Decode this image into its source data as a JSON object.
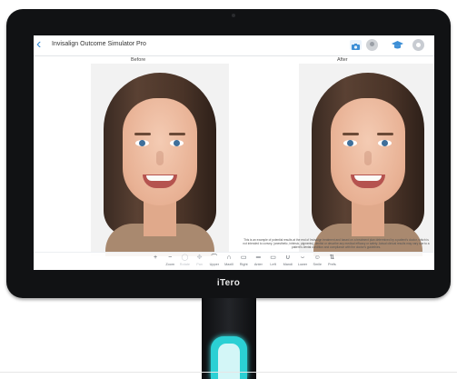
{
  "app": {
    "title": "Invisalign Outcome Simulator Pro",
    "brand": "iTero"
  },
  "header": {
    "back_icon": "chevron-left-icon",
    "camera_icon": "camera-icon",
    "avatar_icon": "user-avatar-icon",
    "graduation_icon": "graduation-cap-icon",
    "settings_icon": "gear-icon",
    "accent_color": "#3d8fd6"
  },
  "panels": {
    "before_label": "Before",
    "after_label": "After"
  },
  "disclaimer": "This is an example of potential results at the end of Invisalign treatment and based on a treatment plan determined by a patient's doctor, which is not intended to convey, (anesthetic, intrinsic, pigments), dentist or describe any medical efficacy or safety. Actual clinical results may vary due to a patient's dental condition and compliance with the doctor's guidelines.",
  "toolbar": {
    "tools": [
      {
        "icon": "+",
        "label": "",
        "name": "zoom-in-icon",
        "enabled": true
      },
      {
        "icon": "−",
        "label": "Zoom",
        "name": "zoom-out-icon",
        "enabled": true
      },
      {
        "icon": "◯",
        "label": "Rotate",
        "name": "rotate-icon",
        "enabled": false
      },
      {
        "icon": "✥",
        "label": "Pan",
        "name": "pan-icon",
        "enabled": false
      },
      {
        "icon": "⌒",
        "label": "Upper",
        "name": "upper-jaw-icon",
        "enabled": true
      },
      {
        "icon": "∩",
        "label": "Maxill",
        "name": "maxill-icon",
        "enabled": true
      },
      {
        "icon": "▭",
        "label": "Right",
        "name": "right-view-icon",
        "enabled": true
      },
      {
        "icon": "═",
        "label": "Anter",
        "name": "anterior-view-icon",
        "enabled": true
      },
      {
        "icon": "▭",
        "label": "Left",
        "name": "left-view-icon",
        "enabled": true
      },
      {
        "icon": "∪",
        "label": "Mandi",
        "name": "mandible-icon",
        "enabled": true
      },
      {
        "icon": "⌣",
        "label": "Lower",
        "name": "lower-jaw-icon",
        "enabled": true
      },
      {
        "icon": "☺",
        "label": "Smile",
        "name": "smile-icon",
        "enabled": true
      },
      {
        "icon": "⇅",
        "label": "Prefs",
        "name": "preferences-icon",
        "enabled": true
      }
    ]
  }
}
